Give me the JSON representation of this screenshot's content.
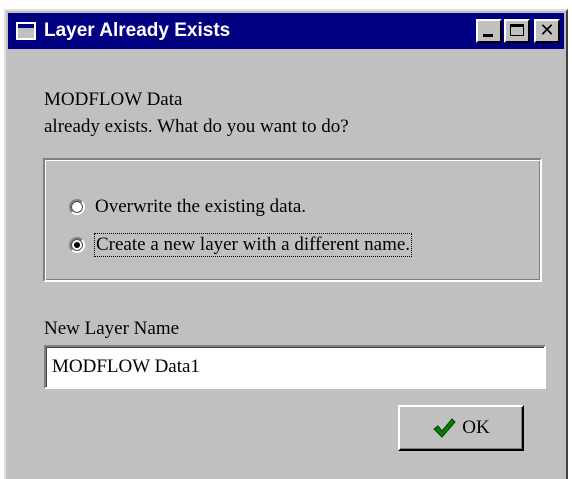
{
  "window": {
    "title": "Layer Already Exists",
    "close_glyph": "✕",
    "icons": [
      "window-menu-icon",
      "minimize-icon",
      "maximize-icon",
      "close-icon"
    ]
  },
  "message": {
    "line1": "MODFLOW Data",
    "line2": "already exists. What do you want to do?"
  },
  "options": [
    {
      "label": "Overwrite the existing data.",
      "selected": false
    },
    {
      "label": "Create a new layer with a different name.",
      "selected": true
    }
  ],
  "new_layer": {
    "label": "New Layer Name",
    "value": "MODFLOW Data1"
  },
  "ok_button": {
    "label": "OK",
    "icon": "checkmark-icon"
  },
  "colors": {
    "title_bar": "#000080",
    "face": "#c0c0c0",
    "check_green": "#008000"
  }
}
